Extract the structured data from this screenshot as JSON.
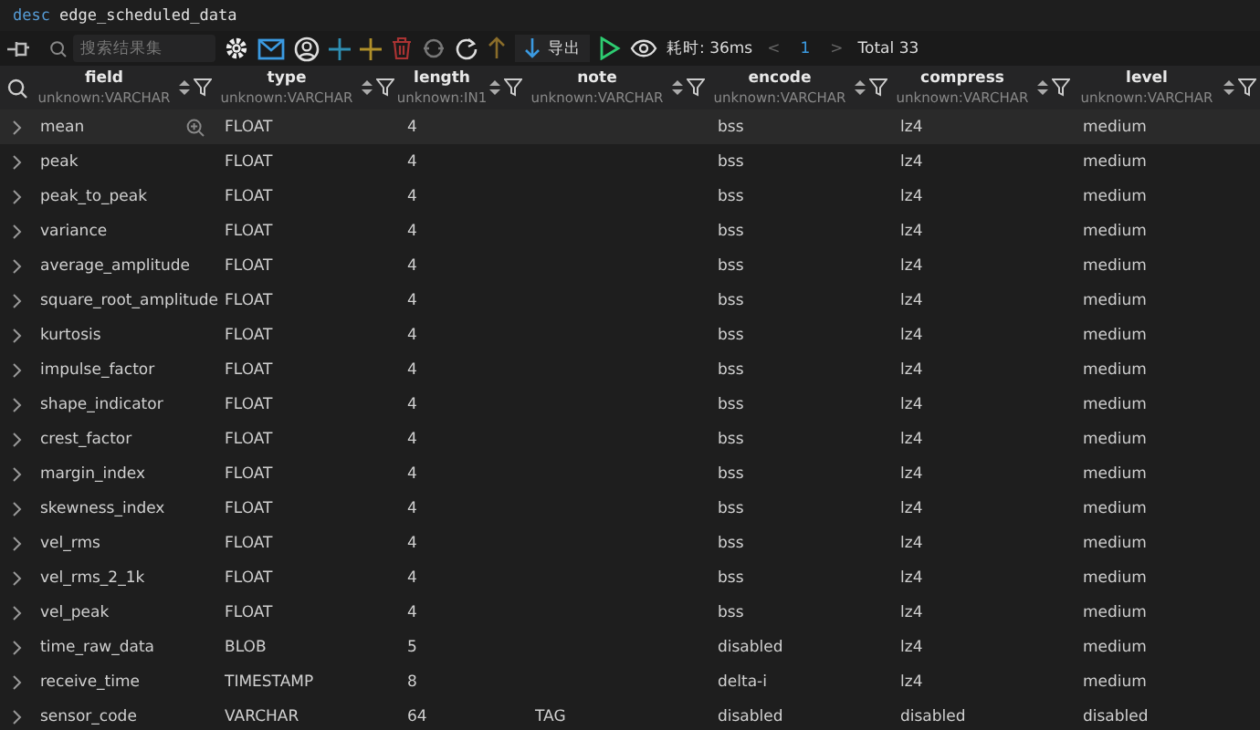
{
  "query": {
    "keyword": "desc",
    "text": "edge_scheduled_data"
  },
  "toolbar": {
    "search_placeholder": "搜索结果集",
    "export_label": "导出",
    "elapsed": "耗时: 36ms",
    "prev": "<",
    "page": "1",
    "next": ">",
    "total": "Total 33"
  },
  "columns": [
    {
      "name": "field",
      "type": "unknown:VARCHAR"
    },
    {
      "name": "type",
      "type": "unknown:VARCHAR"
    },
    {
      "name": "length",
      "type": "unknown:IN1"
    },
    {
      "name": "note",
      "type": "unknown:VARCHAR"
    },
    {
      "name": "encode",
      "type": "unknown:VARCHAR"
    },
    {
      "name": "compress",
      "type": "unknown:VARCHAR"
    },
    {
      "name": "level",
      "type": "unknown:VARCHAR"
    }
  ],
  "rows": [
    {
      "cells": [
        "mean",
        "FLOAT",
        "4",
        "",
        "bss",
        "lz4",
        "medium"
      ],
      "hovered": true
    },
    {
      "cells": [
        "peak",
        "FLOAT",
        "4",
        "",
        "bss",
        "lz4",
        "medium"
      ],
      "hovered": false
    },
    {
      "cells": [
        "peak_to_peak",
        "FLOAT",
        "4",
        "",
        "bss",
        "lz4",
        "medium"
      ],
      "hovered": false
    },
    {
      "cells": [
        "variance",
        "FLOAT",
        "4",
        "",
        "bss",
        "lz4",
        "medium"
      ],
      "hovered": false
    },
    {
      "cells": [
        "average_amplitude",
        "FLOAT",
        "4",
        "",
        "bss",
        "lz4",
        "medium"
      ],
      "hovered": false
    },
    {
      "cells": [
        "square_root_amplitude",
        "FLOAT",
        "4",
        "",
        "bss",
        "lz4",
        "medium"
      ],
      "hovered": false
    },
    {
      "cells": [
        "kurtosis",
        "FLOAT",
        "4",
        "",
        "bss",
        "lz4",
        "medium"
      ],
      "hovered": false
    },
    {
      "cells": [
        "impulse_factor",
        "FLOAT",
        "4",
        "",
        "bss",
        "lz4",
        "medium"
      ],
      "hovered": false
    },
    {
      "cells": [
        "shape_indicator",
        "FLOAT",
        "4",
        "",
        "bss",
        "lz4",
        "medium"
      ],
      "hovered": false
    },
    {
      "cells": [
        "crest_factor",
        "FLOAT",
        "4",
        "",
        "bss",
        "lz4",
        "medium"
      ],
      "hovered": false
    },
    {
      "cells": [
        "margin_index",
        "FLOAT",
        "4",
        "",
        "bss",
        "lz4",
        "medium"
      ],
      "hovered": false
    },
    {
      "cells": [
        "skewness_index",
        "FLOAT",
        "4",
        "",
        "bss",
        "lz4",
        "medium"
      ],
      "hovered": false
    },
    {
      "cells": [
        "vel_rms",
        "FLOAT",
        "4",
        "",
        "bss",
        "lz4",
        "medium"
      ],
      "hovered": false
    },
    {
      "cells": [
        "vel_rms_2_1k",
        "FLOAT",
        "4",
        "",
        "bss",
        "lz4",
        "medium"
      ],
      "hovered": false
    },
    {
      "cells": [
        "vel_peak",
        "FLOAT",
        "4",
        "",
        "bss",
        "lz4",
        "medium"
      ],
      "hovered": false
    },
    {
      "cells": [
        "time_raw_data",
        "BLOB",
        "5",
        "",
        "disabled",
        "lz4",
        "medium"
      ],
      "hovered": false
    },
    {
      "cells": [
        "receive_time",
        "TIMESTAMP",
        "8",
        "",
        "delta-i",
        "lz4",
        "medium"
      ],
      "hovered": false
    },
    {
      "cells": [
        "sensor_code",
        "VARCHAR",
        "64",
        "TAG",
        "disabled",
        "disabled",
        "disabled"
      ],
      "hovered": false
    }
  ]
}
